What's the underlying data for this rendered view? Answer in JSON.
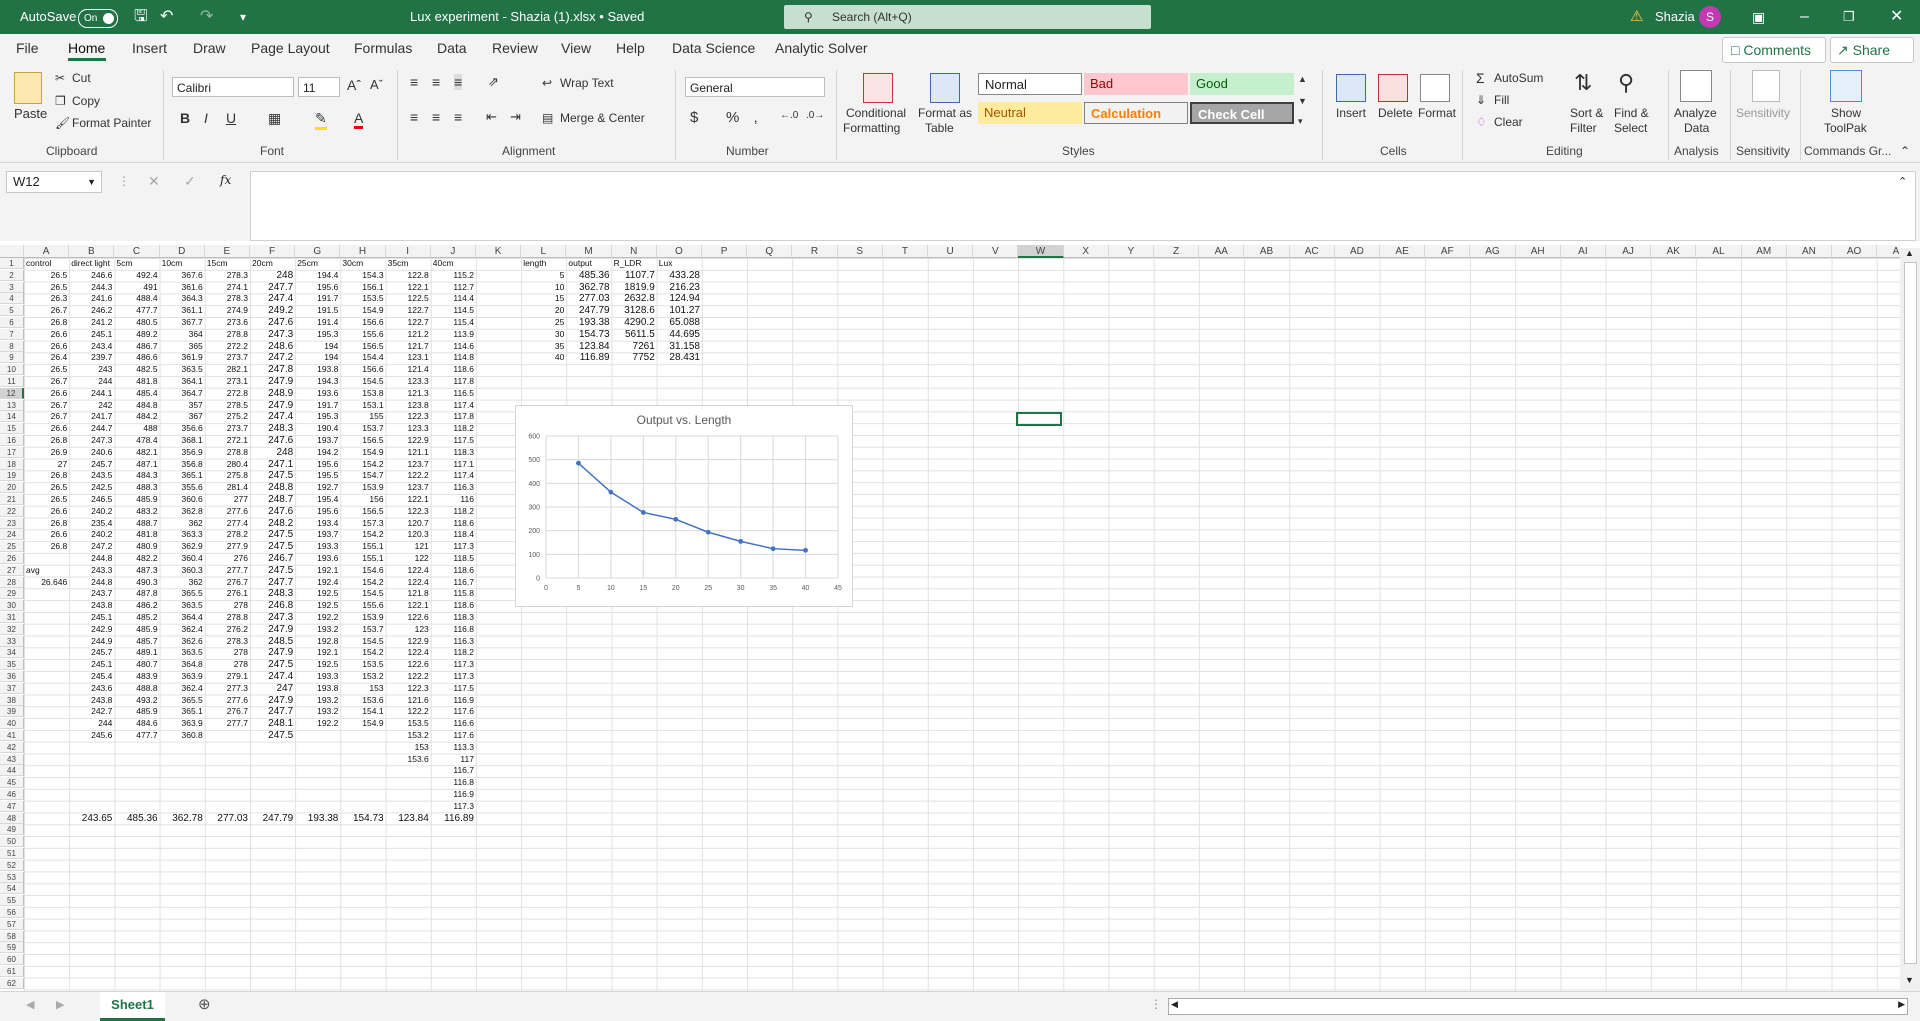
{
  "titlebar": {
    "autosave_label": "AutoSave",
    "autosave_state": "On",
    "file_title": "Lux experiment - Shazia (1).xlsx • Saved",
    "search_placeholder": "Search (Alt+Q)",
    "user_name": "Shazia",
    "user_initial": "S"
  },
  "menu": {
    "tabs": [
      "File",
      "Home",
      "Insert",
      "Draw",
      "Page Layout",
      "Formulas",
      "Data",
      "Review",
      "View",
      "Help",
      "Data Science",
      "Analytic Solver"
    ],
    "active_tab": "Home",
    "comments_label": "Comments",
    "share_label": "Share"
  },
  "ribbon": {
    "clipboard": {
      "paste": "Paste",
      "cut": "Cut",
      "copy": "Copy",
      "format_painter": "Format Painter",
      "group": "Clipboard"
    },
    "font": {
      "name": "Calibri",
      "size": "11",
      "group": "Font"
    },
    "alignment": {
      "wrap_text": "Wrap Text",
      "merge_center": "Merge & Center",
      "group": "Alignment"
    },
    "number": {
      "format": "General",
      "group": "Number"
    },
    "styles": {
      "conditional_1": "Conditional",
      "conditional_2": "Formatting",
      "format_as_1": "Format as",
      "format_as_2": "Table",
      "normal": "Normal",
      "bad": "Bad",
      "good": "Good",
      "neutral": "Neutral",
      "calculation": "Calculation",
      "check_cell": "Check Cell",
      "group": "Styles"
    },
    "cells": {
      "insert": "Insert",
      "delete": "Delete",
      "format": "Format",
      "group": "Cells"
    },
    "editing": {
      "autosum": "AutoSum",
      "fill": "Fill",
      "clear": "Clear",
      "sort_1": "Sort &",
      "sort_2": "Filter",
      "find_1": "Find &",
      "find_2": "Select",
      "group": "Editing"
    },
    "analysis": {
      "label_1": "Analyze",
      "label_2": "Data",
      "group": "Analysis"
    },
    "sensitivity": {
      "label": "Sensitivity",
      "group": "Sensitivity"
    },
    "toolpak": {
      "label_1": "Show",
      "label_2": "ToolPak",
      "group": "Commands Gr..."
    }
  },
  "formula_bar": {
    "name_box": "W12",
    "fx": "fx",
    "content": ""
  },
  "columns": [
    "A",
    "B",
    "C",
    "D",
    "E",
    "F",
    "G",
    "H",
    "I",
    "J",
    "K",
    "L",
    "M",
    "N",
    "O",
    "P",
    "Q",
    "R",
    "S",
    "T",
    "U",
    "V",
    "W",
    "X",
    "Y",
    "Z",
    "AA",
    "AB",
    "AC",
    "AD",
    "AE",
    "AF",
    "AG",
    "AH",
    "AI",
    "AJ",
    "AK",
    "AL",
    "AM",
    "AN",
    "AO",
    "AP"
  ],
  "headers_row1": [
    "control",
    "direct light",
    "5cm",
    "10cm",
    "15cm",
    "20cm",
    "25cm",
    "30cm",
    "35cm",
    "40cm"
  ],
  "data_rows": [
    [
      "26.5",
      "246.6",
      "492.4",
      "367.6",
      "278.3",
      "248",
      "194.4",
      "154.3",
      "122.8",
      "115.2"
    ],
    [
      "26.5",
      "244.3",
      "491",
      "361.6",
      "274.1",
      "247.7",
      "195.6",
      "156.1",
      "122.1",
      "112.7"
    ],
    [
      "26.3",
      "241.6",
      "488.4",
      "364.3",
      "278.3",
      "247.4",
      "191.7",
      "153.5",
      "122.5",
      "114.4"
    ],
    [
      "26.7",
      "246.2",
      "477.7",
      "361.1",
      "274.9",
      "249.2",
      "191.5",
      "154.9",
      "122.7",
      "114.5"
    ],
    [
      "26.8",
      "241.2",
      "480.5",
      "367.7",
      "273.6",
      "247.6",
      "191.4",
      "156.6",
      "122.7",
      "115.4"
    ],
    [
      "26.6",
      "245.1",
      "489.2",
      "364",
      "278.8",
      "247.3",
      "195.3",
      "155.6",
      "121.2",
      "113.9"
    ],
    [
      "26.6",
      "243.4",
      "486.7",
      "365",
      "272.2",
      "248.6",
      "194",
      "156.5",
      "121.7",
      "114.6"
    ],
    [
      "26.4",
      "239.7",
      "486.6",
      "361.9",
      "273.7",
      "247.2",
      "194",
      "154.4",
      "123.1",
      "114.8"
    ],
    [
      "26.5",
      "243",
      "482.5",
      "363.5",
      "282.1",
      "247.8",
      "193.8",
      "156.6",
      "121.4",
      "118.6"
    ],
    [
      "26.7",
      "244",
      "481.8",
      "364.1",
      "273.1",
      "247.9",
      "194.3",
      "154.5",
      "123.3",
      "117.8"
    ],
    [
      "26.6",
      "244.1",
      "485.4",
      "364.7",
      "272.8",
      "248.9",
      "193.6",
      "153.8",
      "121.3",
      "116.5"
    ],
    [
      "26.7",
      "242",
      "484.8",
      "357",
      "278.5",
      "247.9",
      "191.7",
      "153.1",
      "123.8",
      "117.4"
    ],
    [
      "26.7",
      "241.7",
      "484.2",
      "367",
      "275.2",
      "247.4",
      "195.3",
      "155",
      "122.3",
      "117.8"
    ],
    [
      "26.6",
      "244.7",
      "488",
      "356.6",
      "273.7",
      "248.3",
      "190.4",
      "153.7",
      "123.3",
      "118.2"
    ],
    [
      "26.8",
      "247.3",
      "478.4",
      "368.1",
      "272.1",
      "247.6",
      "193.7",
      "156.5",
      "122.9",
      "117.5"
    ],
    [
      "26.9",
      "240.6",
      "482.1",
      "356.9",
      "278.8",
      "248",
      "194.2",
      "154.9",
      "121.1",
      "118.3"
    ],
    [
      "27",
      "245.7",
      "487.1",
      "356.8",
      "280.4",
      "247.1",
      "195.6",
      "154.2",
      "123.7",
      "117.1"
    ],
    [
      "26.8",
      "243.5",
      "484.3",
      "365.1",
      "275.8",
      "247.5",
      "195.5",
      "154.7",
      "122.2",
      "117.4"
    ],
    [
      "26.5",
      "242.5",
      "488.3",
      "355.6",
      "281.4",
      "248.8",
      "192.7",
      "153.9",
      "123.7",
      "116.3"
    ],
    [
      "26.5",
      "246.5",
      "485.9",
      "360.6",
      "277",
      "248.7",
      "195.4",
      "156",
      "122.1",
      "116"
    ],
    [
      "26.6",
      "240.2",
      "483.2",
      "362.8",
      "277.6",
      "247.6",
      "195.6",
      "156.5",
      "122.3",
      "118.2"
    ],
    [
      "26.8",
      "235.4",
      "488.7",
      "362",
      "277.4",
      "248.2",
      "193.4",
      "157.3",
      "120.7",
      "118.6"
    ],
    [
      "26.6",
      "240.2",
      "481.8",
      "363.3",
      "278.2",
      "247.5",
      "193.7",
      "154.2",
      "120.3",
      "118.4"
    ],
    [
      "26.8",
      "247.2",
      "480.9",
      "362.9",
      "277.9",
      "247.5",
      "193.3",
      "155.1",
      "121",
      "117.3"
    ],
    [
      "",
      "244.8",
      "482.2",
      "360.4",
      "276",
      "246.7",
      "193.6",
      "155.1",
      "122",
      "118.5"
    ],
    [
      "avg",
      "243.3",
      "487.3",
      "360.3",
      "277.7",
      "247.5",
      "192.1",
      "154.6",
      "122.4",
      "118.6"
    ],
    [
      "26.646",
      "244.8",
      "490.3",
      "362",
      "276.7",
      "247.7",
      "192.4",
      "154.2",
      "122.4",
      "116.7"
    ],
    [
      "",
      "243.7",
      "487.8",
      "365.5",
      "276.1",
      "248.3",
      "192.5",
      "154.5",
      "121.8",
      "115.8"
    ],
    [
      "",
      "243.8",
      "486.2",
      "363.5",
      "278",
      "246.8",
      "192.5",
      "155.6",
      "122.1",
      "118.6"
    ],
    [
      "",
      "245.1",
      "485.2",
      "364.4",
      "278.8",
      "247.3",
      "192.2",
      "153.9",
      "122.6",
      "118.3"
    ],
    [
      "",
      "242.9",
      "485.9",
      "362.4",
      "276.2",
      "247.9",
      "193.2",
      "153.7",
      "123",
      "116.8"
    ],
    [
      "",
      "244.9",
      "485.7",
      "362.6",
      "278.3",
      "248.5",
      "192.8",
      "154.5",
      "122.9",
      "116.3"
    ],
    [
      "",
      "245.7",
      "489.1",
      "363.5",
      "278",
      "247.9",
      "192.1",
      "154.2",
      "122.4",
      "118.2"
    ],
    [
      "",
      "245.1",
      "480.7",
      "364.8",
      "278",
      "247.5",
      "192.5",
      "153.5",
      "122.6",
      "117.3"
    ],
    [
      "",
      "245.4",
      "483.9",
      "363.9",
      "279.1",
      "247.4",
      "193.3",
      "153.2",
      "122.2",
      "117.3"
    ],
    [
      "",
      "243.6",
      "488.8",
      "362.4",
      "277.3",
      "247",
      "193.8",
      "153",
      "122.3",
      "117.5"
    ],
    [
      "",
      "243.8",
      "493.2",
      "365.5",
      "277.6",
      "247.9",
      "193.2",
      "153.6",
      "121.6",
      "116.9"
    ],
    [
      "",
      "242.7",
      "485.9",
      "365.1",
      "276.7",
      "247.7",
      "193.2",
      "154.1",
      "122.2",
      "117.6"
    ],
    [
      "",
      "244",
      "484.6",
      "363.9",
      "277.7",
      "248.1",
      "192.2",
      "154.9",
      "153.5",
      "116.6"
    ],
    [
      "",
      "245.6",
      "477.7",
      "360.8",
      "",
      "247.5",
      "",
      "",
      "153.2",
      "117.6"
    ],
    [
      "",
      "",
      "",
      "",
      "",
      "",
      "",
      "",
      "153",
      "113.3"
    ],
    [
      "",
      "",
      "",
      "",
      "",
      "",
      "",
      "",
      "153.6",
      "117"
    ],
    [
      "",
      "",
      "",
      "",
      "",
      "",
      "",
      "",
      "",
      "116.7"
    ],
    [
      "",
      "",
      "",
      "",
      "",
      "",
      "",
      "",
      "",
      "116.8"
    ],
    [
      "",
      "",
      "",
      "",
      "",
      "",
      "",
      "",
      "",
      "116.9"
    ],
    [
      "",
      "",
      "",
      "",
      "",
      "",
      "",
      "",
      "",
      "117.3"
    ],
    [
      "",
      "243.65",
      "485.36",
      "362.78",
      "277.03",
      "247.79",
      "193.38",
      "154.73",
      "123.84",
      "116.89"
    ]
  ],
  "summary_table": {
    "headers": [
      "length",
      "output",
      "R_LDR",
      "Lux"
    ],
    "rows": [
      [
        "5",
        "485.36",
        "1107.7",
        "433.28"
      ],
      [
        "10",
        "362.78",
        "1819.9",
        "216.23"
      ],
      [
        "15",
        "277.03",
        "2632.8",
        "124.94"
      ],
      [
        "20",
        "247.79",
        "3128.6",
        "101.27"
      ],
      [
        "25",
        "193.38",
        "4290.2",
        "65.088"
      ],
      [
        "30",
        "154.73",
        "5611.5",
        "44.695"
      ],
      [
        "35",
        "123.84",
        "7261",
        "31.158"
      ],
      [
        "40",
        "116.89",
        "7752",
        "28.431"
      ]
    ]
  },
  "chart_data": {
    "type": "scatter",
    "title": "Output vs. Length",
    "x": [
      5,
      10,
      15,
      20,
      25,
      30,
      35,
      40
    ],
    "series": [
      {
        "values": [
          485.36,
          362.78,
          277.03,
          247.79,
          193.38,
          154.73,
          123.84,
          116.89
        ]
      }
    ],
    "xlim": [
      0,
      45
    ],
    "ylim": [
      0,
      600
    ],
    "xticks": [
      "0",
      "5",
      "10",
      "15",
      "20",
      "25",
      "30",
      "35",
      "40",
      "45"
    ],
    "yticks": [
      "0",
      "100",
      "200",
      "300",
      "400",
      "500",
      "600"
    ],
    "grid": true,
    "line_color": "#4472c4"
  },
  "sheets": {
    "active": "Sheet1"
  },
  "colors": {
    "excel_green": "#217346"
  }
}
